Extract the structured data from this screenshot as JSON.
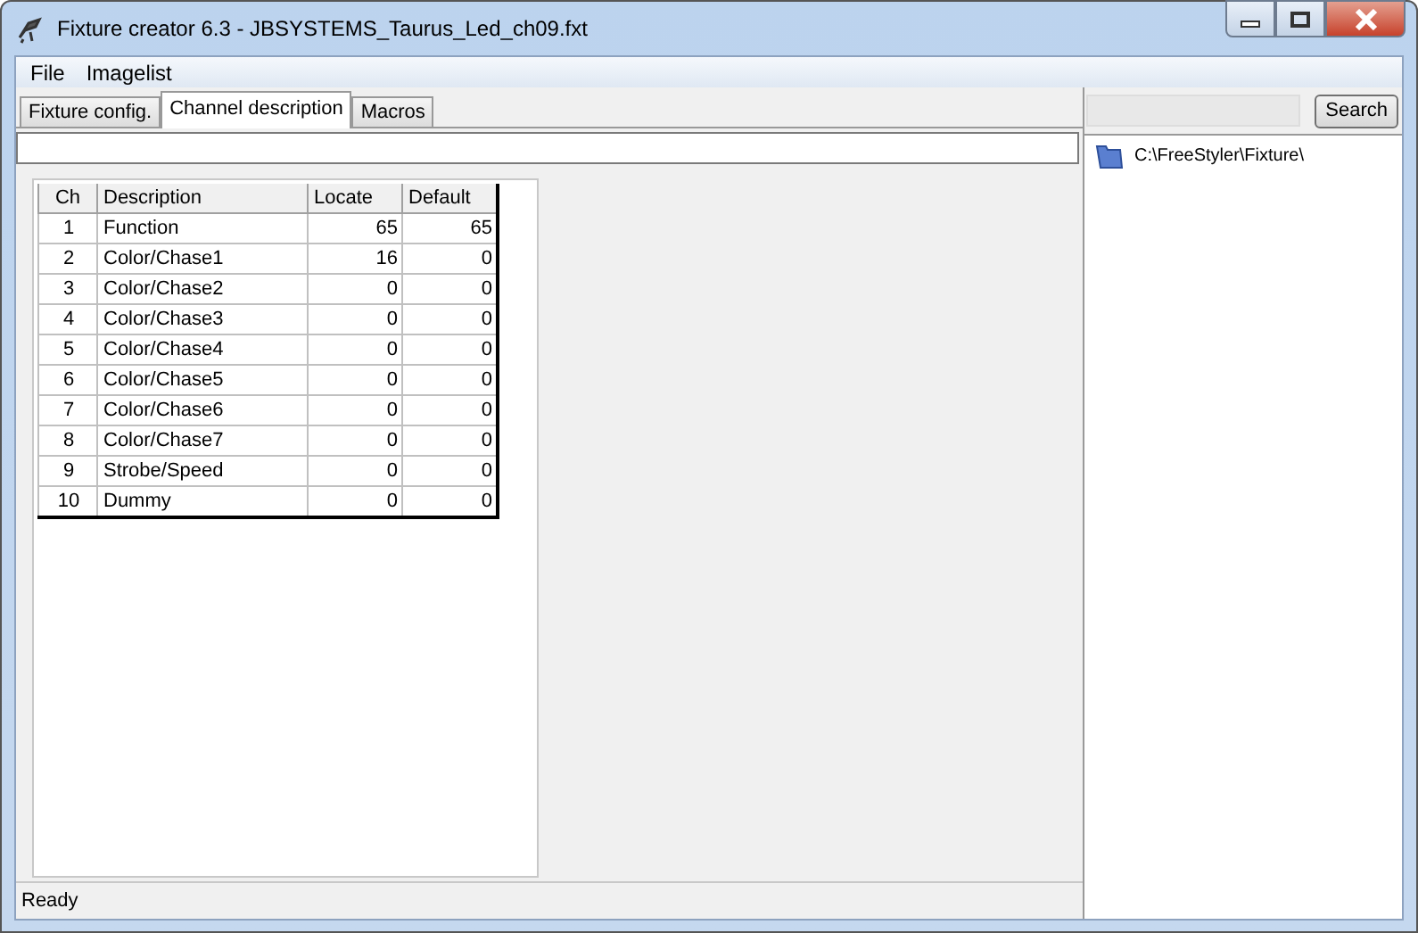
{
  "window": {
    "title": "Fixture creator 6.3 - JBSYSTEMS_Taurus_Led_ch09.fxt"
  },
  "menu": [
    "File",
    "Imagelist"
  ],
  "tabs": [
    {
      "label": "Fixture config.",
      "selected": false
    },
    {
      "label": "Channel description",
      "selected": true
    },
    {
      "label": "Macros",
      "selected": false
    }
  ],
  "table": {
    "columns": [
      "Ch",
      "Description",
      "Locate",
      "Default"
    ],
    "rows": [
      [
        "1",
        "Function",
        "65",
        "65"
      ],
      [
        "2",
        "Color/Chase1",
        "16",
        "0"
      ],
      [
        "3",
        "Color/Chase2",
        "0",
        "0"
      ],
      [
        "4",
        "Color/Chase3",
        "0",
        "0"
      ],
      [
        "5",
        "Color/Chase4",
        "0",
        "0"
      ],
      [
        "6",
        "Color/Chase5",
        "0",
        "0"
      ],
      [
        "7",
        "Color/Chase6",
        "0",
        "0"
      ],
      [
        "8",
        "Color/Chase7",
        "0",
        "0"
      ],
      [
        "9",
        "Strobe/Speed",
        "0",
        "0"
      ],
      [
        "10",
        "Dummy",
        "0",
        "0"
      ]
    ]
  },
  "search": {
    "button": "Search"
  },
  "tree": [
    {
      "label": "C:\\FreeStyler\\Fixture\\"
    }
  ],
  "status_bar": "Ready"
}
